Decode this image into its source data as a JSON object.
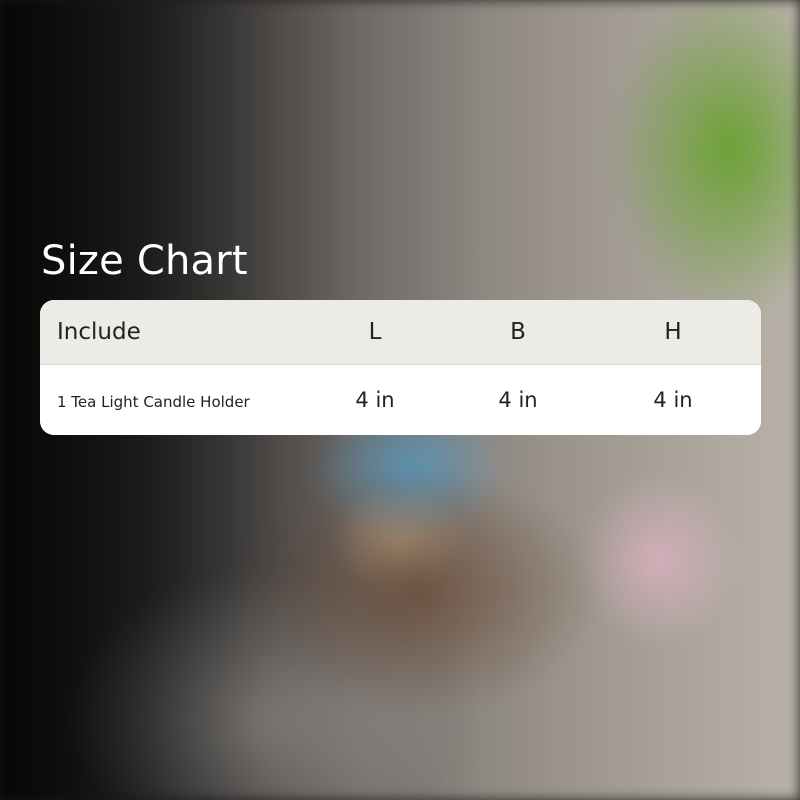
{
  "title": "Size Chart",
  "table": {
    "headers": [
      "Include",
      "L",
      "B",
      "H"
    ],
    "rows": [
      [
        "1 Tea Light Candle Holder",
        "4 in",
        "4 in",
        "4 in"
      ]
    ]
  }
}
